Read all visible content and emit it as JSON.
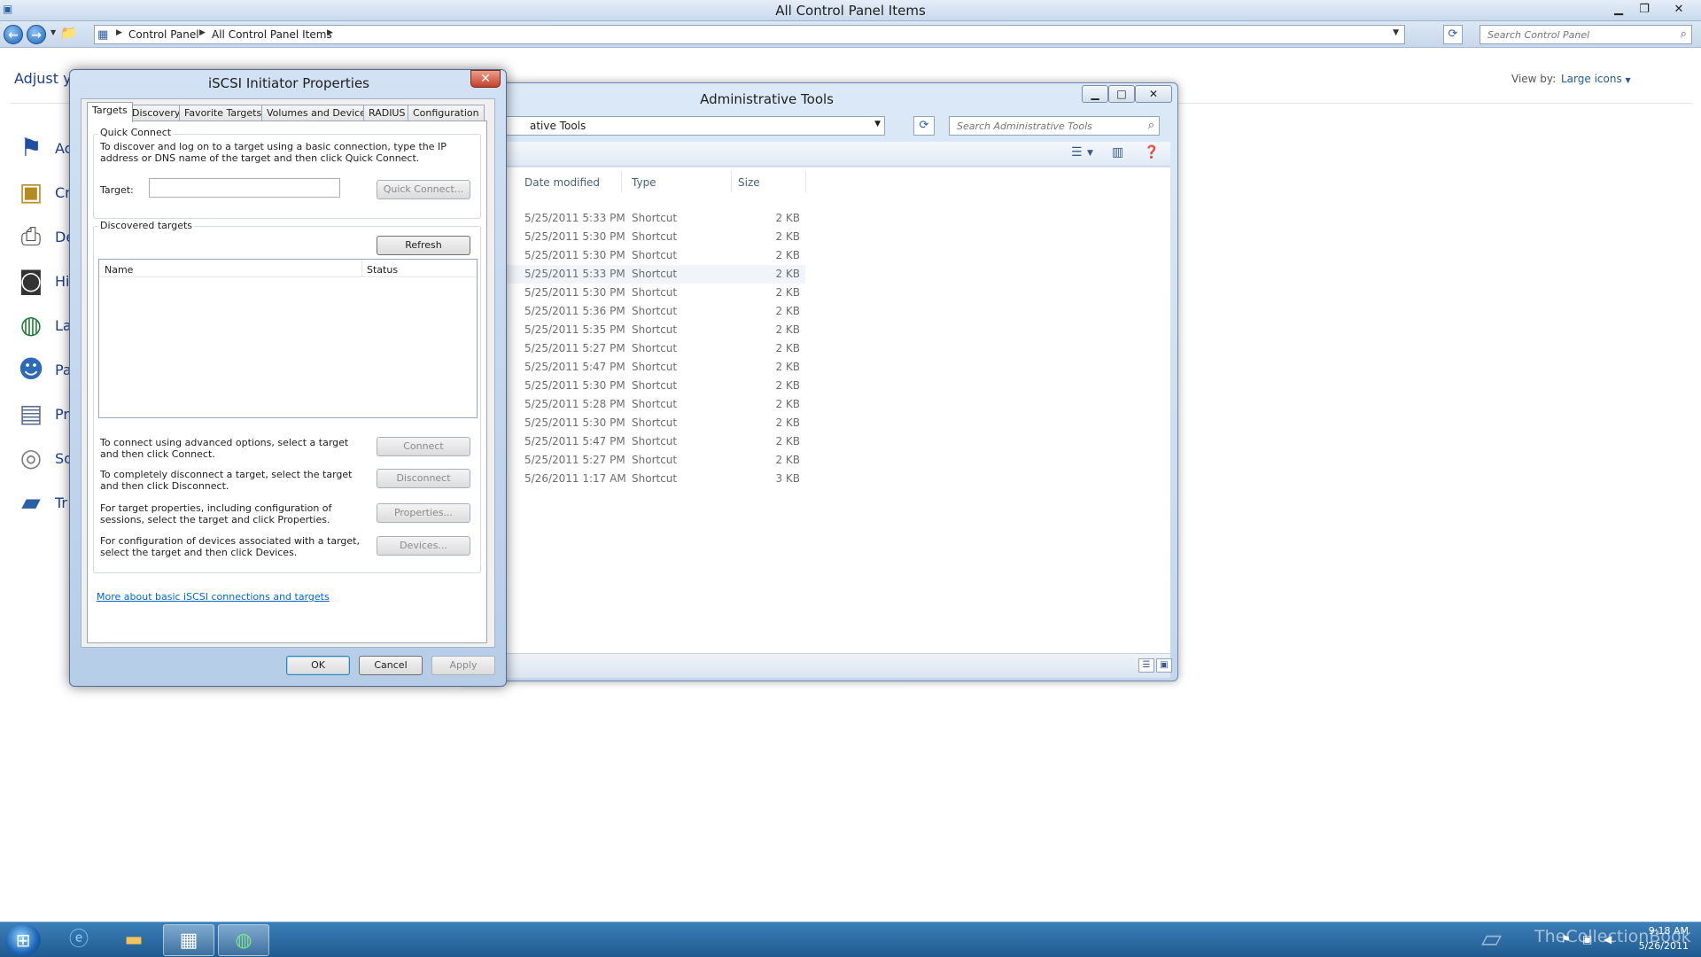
{
  "control_panel": {
    "title": "All Control Panel Items",
    "breadcrumbs": [
      "Control Panel",
      "All Control Panel Items"
    ],
    "search_placeholder": "Search Control Panel",
    "heading": "Adjust y",
    "view_by_label": "View by:",
    "view_by_value": "Large icons",
    "items": [
      {
        "label": "Ac",
        "icon": "flag-icon"
      },
      {
        "label": "Cr",
        "icon": "credential-vault-icon"
      },
      {
        "label": "De",
        "icon": "devices-printers-icon"
      },
      {
        "label": "Hi",
        "icon": "file-history-icon"
      },
      {
        "label": "La",
        "icon": "language-globe-icon"
      },
      {
        "label": "Pa",
        "icon": "parental-controls-icon"
      },
      {
        "label": "Pr",
        "icon": "programs-icon"
      },
      {
        "label": "So",
        "icon": "sound-icon"
      },
      {
        "label": "Tr",
        "icon": "troubleshooting-icon"
      }
    ]
  },
  "admin_tools": {
    "title": "Administrative Tools",
    "address_text": "ative Tools",
    "search_placeholder": "Search Administrative Tools",
    "columns": [
      "Date modified",
      "Type",
      "Size"
    ],
    "rows": [
      {
        "date": "5/25/2011 5:33 PM",
        "type": "Shortcut",
        "size": "2 KB"
      },
      {
        "date": "5/25/2011 5:30 PM",
        "type": "Shortcut",
        "size": "2 KB"
      },
      {
        "date": "5/25/2011 5:30 PM",
        "type": "Shortcut",
        "size": "2 KB"
      },
      {
        "date": "5/25/2011 5:33 PM",
        "type": "Shortcut",
        "size": "2 KB"
      },
      {
        "date": "5/25/2011 5:30 PM",
        "type": "Shortcut",
        "size": "2 KB"
      },
      {
        "date": "5/25/2011 5:36 PM",
        "type": "Shortcut",
        "size": "2 KB"
      },
      {
        "date": "5/25/2011 5:35 PM",
        "type": "Shortcut",
        "size": "2 KB"
      },
      {
        "date": "5/25/2011 5:27 PM",
        "type": "Shortcut",
        "size": "2 KB"
      },
      {
        "date": "5/25/2011 5:47 PM",
        "type": "Shortcut",
        "size": "2 KB"
      },
      {
        "date": "5/25/2011 5:30 PM",
        "type": "Shortcut",
        "size": "2 KB"
      },
      {
        "date": "5/25/2011 5:28 PM",
        "type": "Shortcut",
        "size": "2 KB"
      },
      {
        "date": "5/25/2011 5:30 PM",
        "type": "Shortcut",
        "size": "2 KB"
      },
      {
        "date": "5/25/2011 5:47 PM",
        "type": "Shortcut",
        "size": "2 KB"
      },
      {
        "date": "5/25/2011 5:27 PM",
        "type": "Shortcut",
        "size": "2 KB"
      },
      {
        "date": "5/26/2011 1:17 AM",
        "type": "Shortcut",
        "size": "3 KB"
      }
    ],
    "selected_row": 3
  },
  "iscsi": {
    "title": "iSCSI Initiator Properties",
    "tabs": [
      "Targets",
      "Discovery",
      "Favorite Targets",
      "Volumes and Devices",
      "RADIUS",
      "Configuration"
    ],
    "active_tab": "Targets",
    "quick_connect": {
      "group_label": "Quick Connect",
      "description": "To discover and log on to a target using a basic connection, type the IP address or DNS name of the target and then click Quick Connect.",
      "target_label": "Target:",
      "target_value": "",
      "button": "Quick Connect..."
    },
    "discovered": {
      "group_label": "Discovered targets",
      "refresh_button": "Refresh",
      "columns": [
        "Name",
        "Status"
      ],
      "actions": [
        {
          "text": "To connect using advanced options, select a target and then click Connect.",
          "button": "Connect"
        },
        {
          "text": "To completely disconnect a target, select the target and then click Disconnect.",
          "button": "Disconnect"
        },
        {
          "text": "For target properties, including configuration of sessions, select the target and click Properties.",
          "button": "Properties..."
        },
        {
          "text": "For configuration of devices associated with a target, select the target and then click Devices.",
          "button": "Devices..."
        }
      ]
    },
    "help_link": "More about basic iSCSI connections and targets",
    "ok": "OK",
    "cancel": "Cancel",
    "apply": "Apply"
  },
  "taskbar": {
    "watermark": "TheCollectionBook",
    "time": "9:18 AM",
    "date": "5/26/2011"
  },
  "colors": {
    "accent_blue": "#1e3f8f",
    "link": "#0066cc",
    "taskbar": "#2a6aa3",
    "close_red": "#c4402a"
  }
}
